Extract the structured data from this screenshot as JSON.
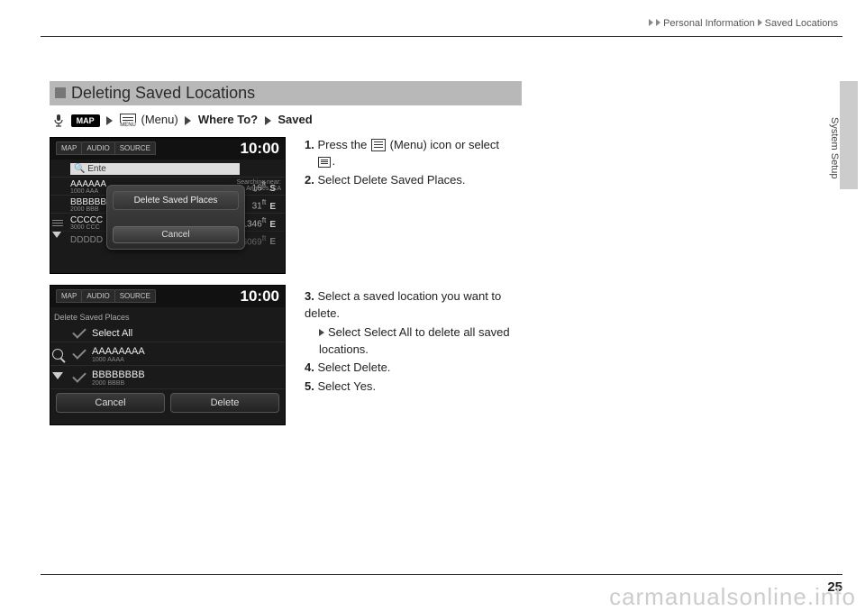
{
  "breadcrumb": {
    "part1": "Personal Information",
    "part2": "Saved Locations"
  },
  "side_label": "System Setup",
  "page_number": "25",
  "watermark": "carmanualsonline.info",
  "section_title": "Deleting Saved Locations",
  "nav": {
    "map": "MAP",
    "menu_text": " (Menu) ",
    "step1": "Where To?",
    "step2": "Saved"
  },
  "screenshot1": {
    "tabs": [
      "MAP",
      "AUDIO",
      "SOURCE"
    ],
    "clock": "10:00",
    "search": "Ente",
    "note1": "Searching near:",
    "note2": "s Angeles, CA",
    "rows": [
      {
        "name": "AAAAAA",
        "sub": "1000 AAA",
        "dist": "16",
        "unit": "ft",
        "dir": "S"
      },
      {
        "name": "BBBBBB",
        "sub": "2000 BBB",
        "dist": "31",
        "unit": "ft",
        "dir": "E"
      },
      {
        "name": "CCCCC",
        "sub": "3000 CCC",
        "dist": "1346",
        "unit": "ft",
        "dir": "E"
      },
      {
        "name": "DDDDD",
        "sub": "",
        "dist": "6069",
        "unit": "ft",
        "dir": "E"
      }
    ],
    "popup_item": "Delete Saved Places",
    "popup_cancel": "Cancel"
  },
  "screenshot2": {
    "tabs": [
      "MAP",
      "AUDIO",
      "SOURCE"
    ],
    "clock": "10:00",
    "title": "Delete Saved Places",
    "rows": [
      {
        "name": "Select All",
        "sub": ""
      },
      {
        "name": "AAAAAAAA",
        "sub": "1000 AAAA"
      },
      {
        "name": "BBBBBBBB",
        "sub": "2000 BBBB"
      }
    ],
    "btn_cancel": "Cancel",
    "btn_delete": "Delete"
  },
  "steps_a": {
    "s1a": "Press the ",
    "s1b": " (Menu) icon or select",
    "s1c": ".",
    "s2a": "Select ",
    "s2b": "Delete Saved Places",
    "s2c": "."
  },
  "steps_b": {
    "s3a": "Select a saved location you want to delete.",
    "s3sub_a": "Select ",
    "s3sub_b": "Select All",
    "s3sub_c": " to delete all saved locations.",
    "s4a": "Select ",
    "s4b": "Delete",
    "s4c": ".",
    "s5a": "Select ",
    "s5b": "Yes",
    "s5c": "."
  }
}
